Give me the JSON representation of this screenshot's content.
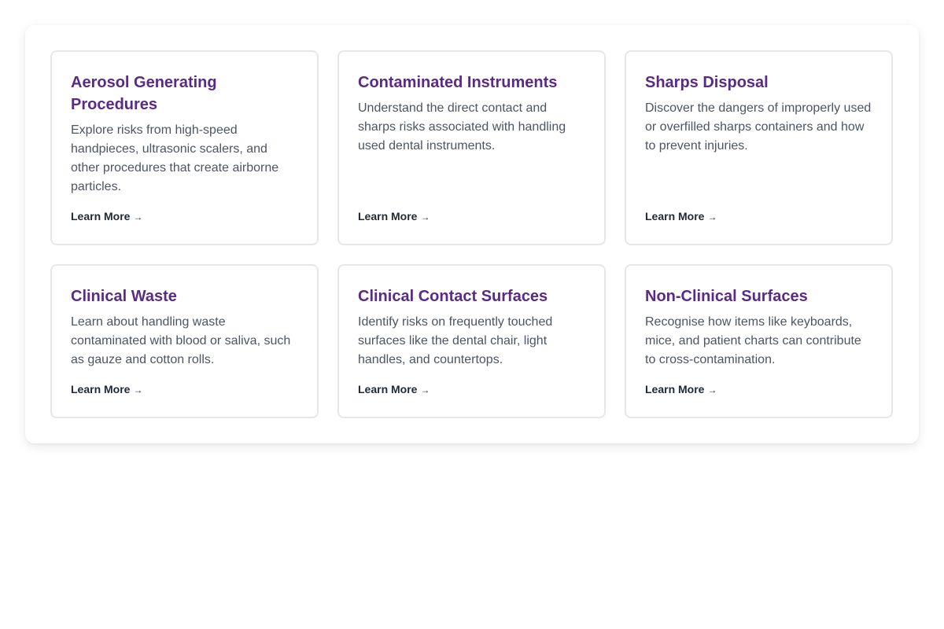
{
  "cards": [
    {
      "title": "Aerosol Generating Procedures",
      "description": "Explore risks from high-speed handpieces, ultrasonic scalers, and other procedures that create airborne particles.",
      "link_label": "Learn More",
      "arrow": "→"
    },
    {
      "title": "Contaminated Instruments",
      "description": "Understand the direct contact and sharps risks associated with handling used dental instruments.",
      "link_label": "Learn More",
      "arrow": "→"
    },
    {
      "title": "Sharps Disposal",
      "description": "Discover the dangers of improperly used or overfilled sharps containers and how to prevent injuries.",
      "link_label": "Learn More",
      "arrow": "→"
    },
    {
      "title": "Clinical Waste",
      "description": "Learn about handling waste contaminated with blood or saliva, such as gauze and cotton rolls.",
      "link_label": "Learn More",
      "arrow": "→"
    },
    {
      "title": "Clinical Contact Surfaces",
      "description": "Identify risks on frequently touched surfaces like the dental chair, light handles, and countertops.",
      "link_label": "Learn More",
      "arrow": "→"
    },
    {
      "title": "Non-Clinical Surfaces",
      "description": "Recognise how items like keyboards, mice, and patient charts can contribute to cross-contamination.",
      "link_label": "Learn More",
      "arrow": "→"
    }
  ],
  "colors": {
    "title": "#5b2a86",
    "description": "#4b5563",
    "link": "#1f2937",
    "card_border": "#e5e7eb"
  }
}
